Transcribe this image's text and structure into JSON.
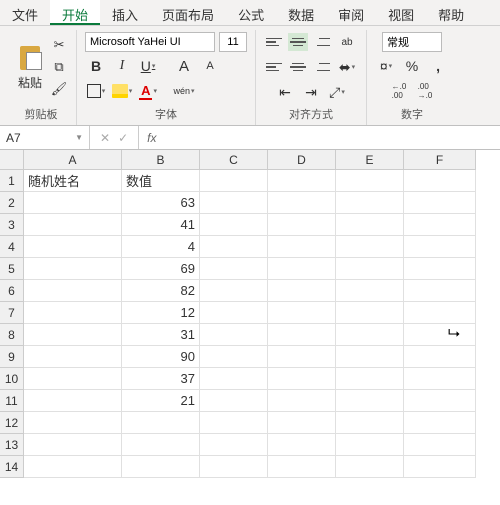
{
  "tabs": [
    "文件",
    "开始",
    "插入",
    "页面布局",
    "公式",
    "数据",
    "审阅",
    "视图",
    "帮助"
  ],
  "active_tab": 1,
  "clipboard": {
    "paste": "粘贴",
    "group": "剪贴板"
  },
  "font": {
    "name": "Microsoft YaHei UI",
    "size": "11",
    "bold": "B",
    "italic": "I",
    "underline": "U",
    "grow": "A",
    "shrink": "A",
    "wen": "wén",
    "fontcolor": "A",
    "group": "字体"
  },
  "align": {
    "wrap": "ab",
    "group": "对齐方式"
  },
  "number": {
    "format": "常规",
    "percent": "%",
    "comma": ",",
    "inc": ".0 .00",
    "dec": ".00 .0",
    "group": "数字"
  },
  "namebox": "A7",
  "fx": "fx",
  "columns": [
    "A",
    "B",
    "C",
    "D",
    "E",
    "F"
  ],
  "rows": [
    "1",
    "2",
    "3",
    "4",
    "5",
    "6",
    "7",
    "8",
    "9",
    "10",
    "11",
    "12",
    "13",
    "14"
  ],
  "cells": {
    "A1": "随机姓名",
    "B1": "数值",
    "B2": "63",
    "B3": "41",
    "B4": "4",
    "B5": "69",
    "B6": "82",
    "B7": "12",
    "B8": "31",
    "B9": "90",
    "B10": "37",
    "B11": "21"
  }
}
